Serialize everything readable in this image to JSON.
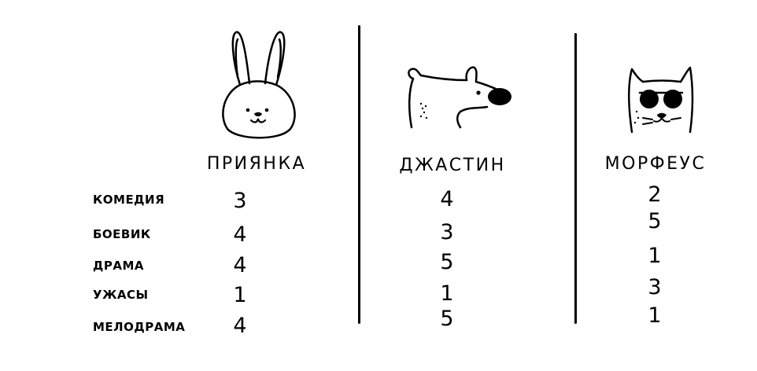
{
  "genres": [
    "КОМЕДИЯ",
    "БОЕВИК",
    "ДРАМА",
    "УЖАСЫ",
    "МЕЛОДРАМА"
  ],
  "characters": [
    {
      "name": "ПРИЯНКА",
      "animal_icon": "rabbit-icon",
      "ratings": [
        "3",
        "4",
        "4",
        "1",
        "4"
      ]
    },
    {
      "name": "ДЖАСТИН",
      "animal_icon": "polar-bear-icon",
      "ratings": [
        "4",
        "3",
        "5",
        "1",
        "5"
      ]
    },
    {
      "name": "МОРФЕУС",
      "animal_icon": "cat-with-sunglasses-icon",
      "ratings": [
        "2",
        "5",
        "1",
        "3",
        "1"
      ]
    }
  ]
}
